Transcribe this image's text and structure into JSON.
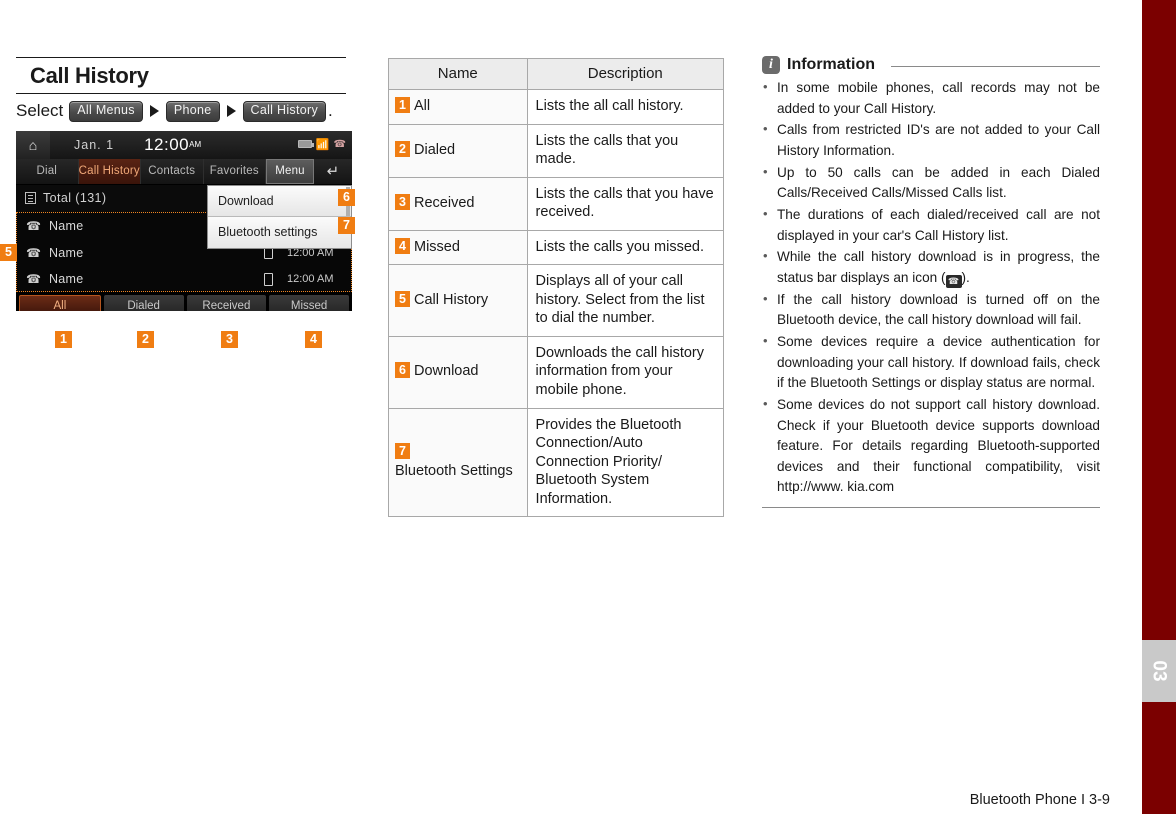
{
  "page": {
    "title": "Call History",
    "footer": "Bluetooth Phone I 3-9",
    "chapter_tab": "03",
    "accent_orange": "#f07d12",
    "edge_red": "#7b0000"
  },
  "select_path": {
    "lead": "Select",
    "chips": [
      "All Menus",
      "Phone",
      "Call History"
    ],
    "period": "."
  },
  "device": {
    "status": {
      "home_icon": "home-icon",
      "date": "Jan.  1",
      "time": "12:00",
      "meridiem": "AM",
      "icons": [
        "battery-icon",
        "bluetooth-icon",
        "phone-signal-icon"
      ]
    },
    "tabs": [
      {
        "label": "Dial",
        "active": false
      },
      {
        "label": "Call History",
        "active": true
      },
      {
        "label": "Contacts",
        "active": false
      },
      {
        "label": "Favorites",
        "active": false
      }
    ],
    "menu_button": "Menu",
    "back_icon": "back-arrow-icon",
    "total_row": "Total (131)",
    "rows": [
      {
        "name": "Name",
        "time": "",
        "show_device": false
      },
      {
        "name": "Name",
        "time": "12:00 AM",
        "show_device": true
      },
      {
        "name": "Name",
        "time": "12:00 AM",
        "show_device": true
      }
    ],
    "filters": [
      {
        "label": "All",
        "active": true
      },
      {
        "label": "Dialed",
        "active": false
      },
      {
        "label": "Received",
        "active": false
      },
      {
        "label": "Missed",
        "active": false
      }
    ],
    "popup": [
      {
        "label": "Download"
      },
      {
        "label": "Bluetooth settings"
      }
    ],
    "badges": [
      "1",
      "2",
      "3",
      "4",
      "5",
      "6",
      "7"
    ]
  },
  "table": {
    "headers": [
      "Name",
      "Description"
    ],
    "rows": [
      {
        "num": "1",
        "name": "All",
        "desc": "Lists the all call history."
      },
      {
        "num": "2",
        "name": "Dialed",
        "desc": "Lists the calls that you made."
      },
      {
        "num": "3",
        "name": "Received",
        "desc": "Lists the calls that you have received."
      },
      {
        "num": "4",
        "name": "Missed",
        "desc": "Lists the calls you missed."
      },
      {
        "num": "5",
        "name": "Call History",
        "desc": "Displays all of your call history. Select from the list to dial the number."
      },
      {
        "num": "6",
        "name": "Download",
        "desc": "Downloads the call history information from your mobile phone."
      },
      {
        "num": "7",
        "name": "Bluetooth Settings",
        "desc": "Provides the Bluetooth Connection/Auto Connection Priority/ Bluetooth System Information."
      }
    ]
  },
  "information": {
    "title": "Information",
    "icon": "info-icon",
    "items": [
      "In some mobile phones, call records may not be added to your Call History.",
      "Calls from restricted ID's are not added to your Call History Information.",
      "Up to 50 calls can be added in each Dialed Calls/Received Calls/Missed Calls list.",
      "The durations of each dialed/received call are not displayed in your car's Call History list."
    ],
    "item_with_icon": {
      "before": "While the call history download is in progress, the status bar displays an icon (",
      "icon": "call-download-icon",
      "after": ").'"
    },
    "items2": [
      "If the call history download is turned off on the Bluetooth device, the call history download will fail.",
      "Some devices require a device authentication for downloading your call history. If download fails, check if the Bluetooth Settings or display status are normal."
    ],
    "last_item": "Some devices do not support call history download. Check if your Bluetooth device supports download feature. For details regarding Bluetooth-supported devices and their functional compatibility, visit http://www. kia.com"
  }
}
